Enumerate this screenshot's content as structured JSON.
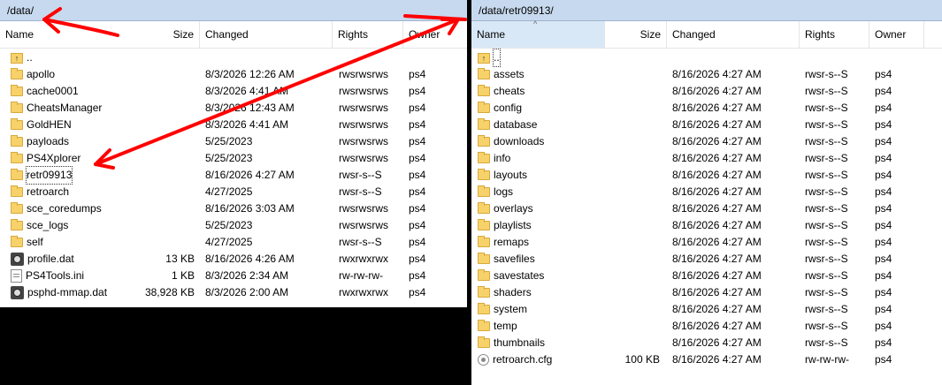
{
  "left": {
    "path": "/data/",
    "columns": {
      "name": "Name",
      "size": "Size",
      "changed": "Changed",
      "rights": "Rights",
      "owner": "Owner"
    },
    "rows": [
      {
        "name": "..",
        "size": "",
        "changed": "",
        "rights": "",
        "owner": "",
        "icon": "up"
      },
      {
        "name": "apollo",
        "size": "",
        "changed": "8/3/2026 12:26 AM",
        "rights": "rwsrwsrws",
        "owner": "ps4",
        "icon": "folder"
      },
      {
        "name": "cache0001",
        "size": "",
        "changed": "8/3/2026 4:41 AM",
        "rights": "rwsrwsrws",
        "owner": "ps4",
        "icon": "folder"
      },
      {
        "name": "CheatsManager",
        "size": "",
        "changed": "8/3/2026 12:43 AM",
        "rights": "rwsrwsrws",
        "owner": "ps4",
        "icon": "folder"
      },
      {
        "name": "GoldHEN",
        "size": "",
        "changed": "8/3/2026 4:41 AM",
        "rights": "rwsrwsrws",
        "owner": "ps4",
        "icon": "folder"
      },
      {
        "name": "payloads",
        "size": "",
        "changed": "5/25/2023",
        "rights": "rwsrwsrws",
        "owner": "ps4",
        "icon": "folder"
      },
      {
        "name": "PS4Xplorer",
        "size": "",
        "changed": "5/25/2023",
        "rights": "rwsrwsrws",
        "owner": "ps4",
        "icon": "folder"
      },
      {
        "name": "retr09913",
        "size": "",
        "changed": "8/16/2026 4:27 AM",
        "rights": "rwsr-s--S",
        "owner": "ps4",
        "icon": "folder",
        "focused": true
      },
      {
        "name": "retroarch",
        "size": "",
        "changed": "4/27/2025",
        "rights": "rwsr-s--S",
        "owner": "ps4",
        "icon": "folder"
      },
      {
        "name": "sce_coredumps",
        "size": "",
        "changed": "8/16/2026 3:03 AM",
        "rights": "rwsrwsrws",
        "owner": "ps4",
        "icon": "folder"
      },
      {
        "name": "sce_logs",
        "size": "",
        "changed": "5/25/2023",
        "rights": "rwsrwsrws",
        "owner": "ps4",
        "icon": "folder"
      },
      {
        "name": "self",
        "size": "",
        "changed": "4/27/2025",
        "rights": "rwsr-s--S",
        "owner": "ps4",
        "icon": "folder"
      },
      {
        "name": "profile.dat",
        "size": "13 KB",
        "changed": "8/16/2026 4:26 AM",
        "rights": "rwxrwxrwx",
        "owner": "ps4",
        "icon": "dat"
      },
      {
        "name": "PS4Tools.ini",
        "size": "1 KB",
        "changed": "8/3/2026 2:34 AM",
        "rights": "rw-rw-rw-",
        "owner": "ps4",
        "icon": "file"
      },
      {
        "name": "psphd-mmap.dat",
        "size": "38,928 KB",
        "changed": "8/3/2026 2:00 AM",
        "rights": "rwxrwxrwx",
        "owner": "ps4",
        "icon": "dat"
      }
    ]
  },
  "right": {
    "path": "/data/retr09913/",
    "columns": {
      "name": "Name",
      "size": "Size",
      "changed": "Changed",
      "rights": "Rights",
      "owner": "Owner"
    },
    "rows": [
      {
        "name": "..",
        "size": "",
        "changed": "",
        "rights": "",
        "owner": "",
        "icon": "up",
        "focused": true
      },
      {
        "name": "assets",
        "size": "",
        "changed": "8/16/2026 4:27 AM",
        "rights": "rwsr-s--S",
        "owner": "ps4",
        "icon": "folder"
      },
      {
        "name": "cheats",
        "size": "",
        "changed": "8/16/2026 4:27 AM",
        "rights": "rwsr-s--S",
        "owner": "ps4",
        "icon": "folder"
      },
      {
        "name": "config",
        "size": "",
        "changed": "8/16/2026 4:27 AM",
        "rights": "rwsr-s--S",
        "owner": "ps4",
        "icon": "folder"
      },
      {
        "name": "database",
        "size": "",
        "changed": "8/16/2026 4:27 AM",
        "rights": "rwsr-s--S",
        "owner": "ps4",
        "icon": "folder"
      },
      {
        "name": "downloads",
        "size": "",
        "changed": "8/16/2026 4:27 AM",
        "rights": "rwsr-s--S",
        "owner": "ps4",
        "icon": "folder"
      },
      {
        "name": "info",
        "size": "",
        "changed": "8/16/2026 4:27 AM",
        "rights": "rwsr-s--S",
        "owner": "ps4",
        "icon": "folder"
      },
      {
        "name": "layouts",
        "size": "",
        "changed": "8/16/2026 4:27 AM",
        "rights": "rwsr-s--S",
        "owner": "ps4",
        "icon": "folder"
      },
      {
        "name": "logs",
        "size": "",
        "changed": "8/16/2026 4:27 AM",
        "rights": "rwsr-s--S",
        "owner": "ps4",
        "icon": "folder"
      },
      {
        "name": "overlays",
        "size": "",
        "changed": "8/16/2026 4:27 AM",
        "rights": "rwsr-s--S",
        "owner": "ps4",
        "icon": "folder"
      },
      {
        "name": "playlists",
        "size": "",
        "changed": "8/16/2026 4:27 AM",
        "rights": "rwsr-s--S",
        "owner": "ps4",
        "icon": "folder"
      },
      {
        "name": "remaps",
        "size": "",
        "changed": "8/16/2026 4:27 AM",
        "rights": "rwsr-s--S",
        "owner": "ps4",
        "icon": "folder"
      },
      {
        "name": "savefiles",
        "size": "",
        "changed": "8/16/2026 4:27 AM",
        "rights": "rwsr-s--S",
        "owner": "ps4",
        "icon": "folder"
      },
      {
        "name": "savestates",
        "size": "",
        "changed": "8/16/2026 4:27 AM",
        "rights": "rwsr-s--S",
        "owner": "ps4",
        "icon": "folder"
      },
      {
        "name": "shaders",
        "size": "",
        "changed": "8/16/2026 4:27 AM",
        "rights": "rwsr-s--S",
        "owner": "ps4",
        "icon": "folder"
      },
      {
        "name": "system",
        "size": "",
        "changed": "8/16/2026 4:27 AM",
        "rights": "rwsr-s--S",
        "owner": "ps4",
        "icon": "folder"
      },
      {
        "name": "temp",
        "size": "",
        "changed": "8/16/2026 4:27 AM",
        "rights": "rwsr-s--S",
        "owner": "ps4",
        "icon": "folder"
      },
      {
        "name": "thumbnails",
        "size": "",
        "changed": "8/16/2026 4:27 AM",
        "rights": "rwsr-s--S",
        "owner": "ps4",
        "icon": "folder"
      },
      {
        "name": "retroarch.cfg",
        "size": "100 KB",
        "changed": "8/16/2026 4:27 AM",
        "rights": "rw-rw-rw-",
        "owner": "ps4",
        "icon": "cfg"
      }
    ]
  },
  "annotation": {
    "color": "#ff0000"
  }
}
